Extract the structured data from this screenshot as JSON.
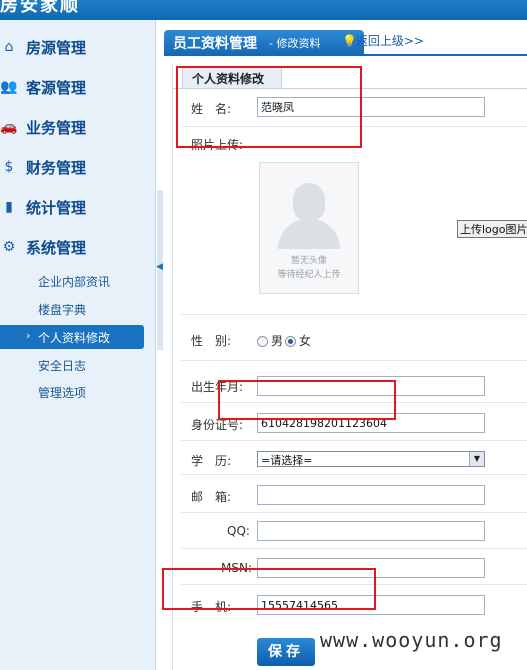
{
  "app": {
    "title": "房安家顺"
  },
  "sidebar": {
    "items": [
      {
        "label": "房源管理",
        "icon": "house-icon"
      },
      {
        "label": "客源管理",
        "icon": "users-icon"
      },
      {
        "label": "业务管理",
        "icon": "car-icon"
      },
      {
        "label": "财务管理",
        "icon": "money-icon"
      },
      {
        "label": "统计管理",
        "icon": "chart-icon"
      },
      {
        "label": "系统管理",
        "icon": "gear-icon"
      }
    ],
    "subitems": [
      {
        "label": "企业内部资讯"
      },
      {
        "label": "楼盘字典"
      },
      {
        "label": "个人资料修改",
        "active": true
      },
      {
        "label": "安全日志"
      },
      {
        "label": "管理选项"
      }
    ]
  },
  "header": {
    "title": "员工资料管理",
    "subtitle": "- 修改资料",
    "back_link": "返回上级>>"
  },
  "form": {
    "tab": "个人资料修改",
    "name_label": "姓　名:",
    "name_value": "范晓凤",
    "photo_label": "照片上传:",
    "photo_caption1": "暂无头像",
    "photo_caption2": "等待经纪人上传",
    "upload_button": "上传logo图片",
    "gender_label": "性　别:",
    "gender_male": "男",
    "gender_female": "女",
    "gender_selected": "女",
    "birth_label": "出生年月:",
    "birth_value": "",
    "id_label": "身份证号:",
    "id_value": "610428198201123604",
    "edu_label": "学　历:",
    "edu_value": "=请选择=",
    "email_label": "邮　箱:",
    "email_value": "",
    "qq_label": "QQ:",
    "qq_value": "",
    "msn_label": "MSN:",
    "msn_value": "",
    "mobile_label": "手　机:",
    "mobile_value": "15557414565",
    "save_button": "保存"
  },
  "watermark": "www.wooyun.org",
  "colors": {
    "accent": "#1a73c0",
    "highlight": "#e0191f"
  }
}
